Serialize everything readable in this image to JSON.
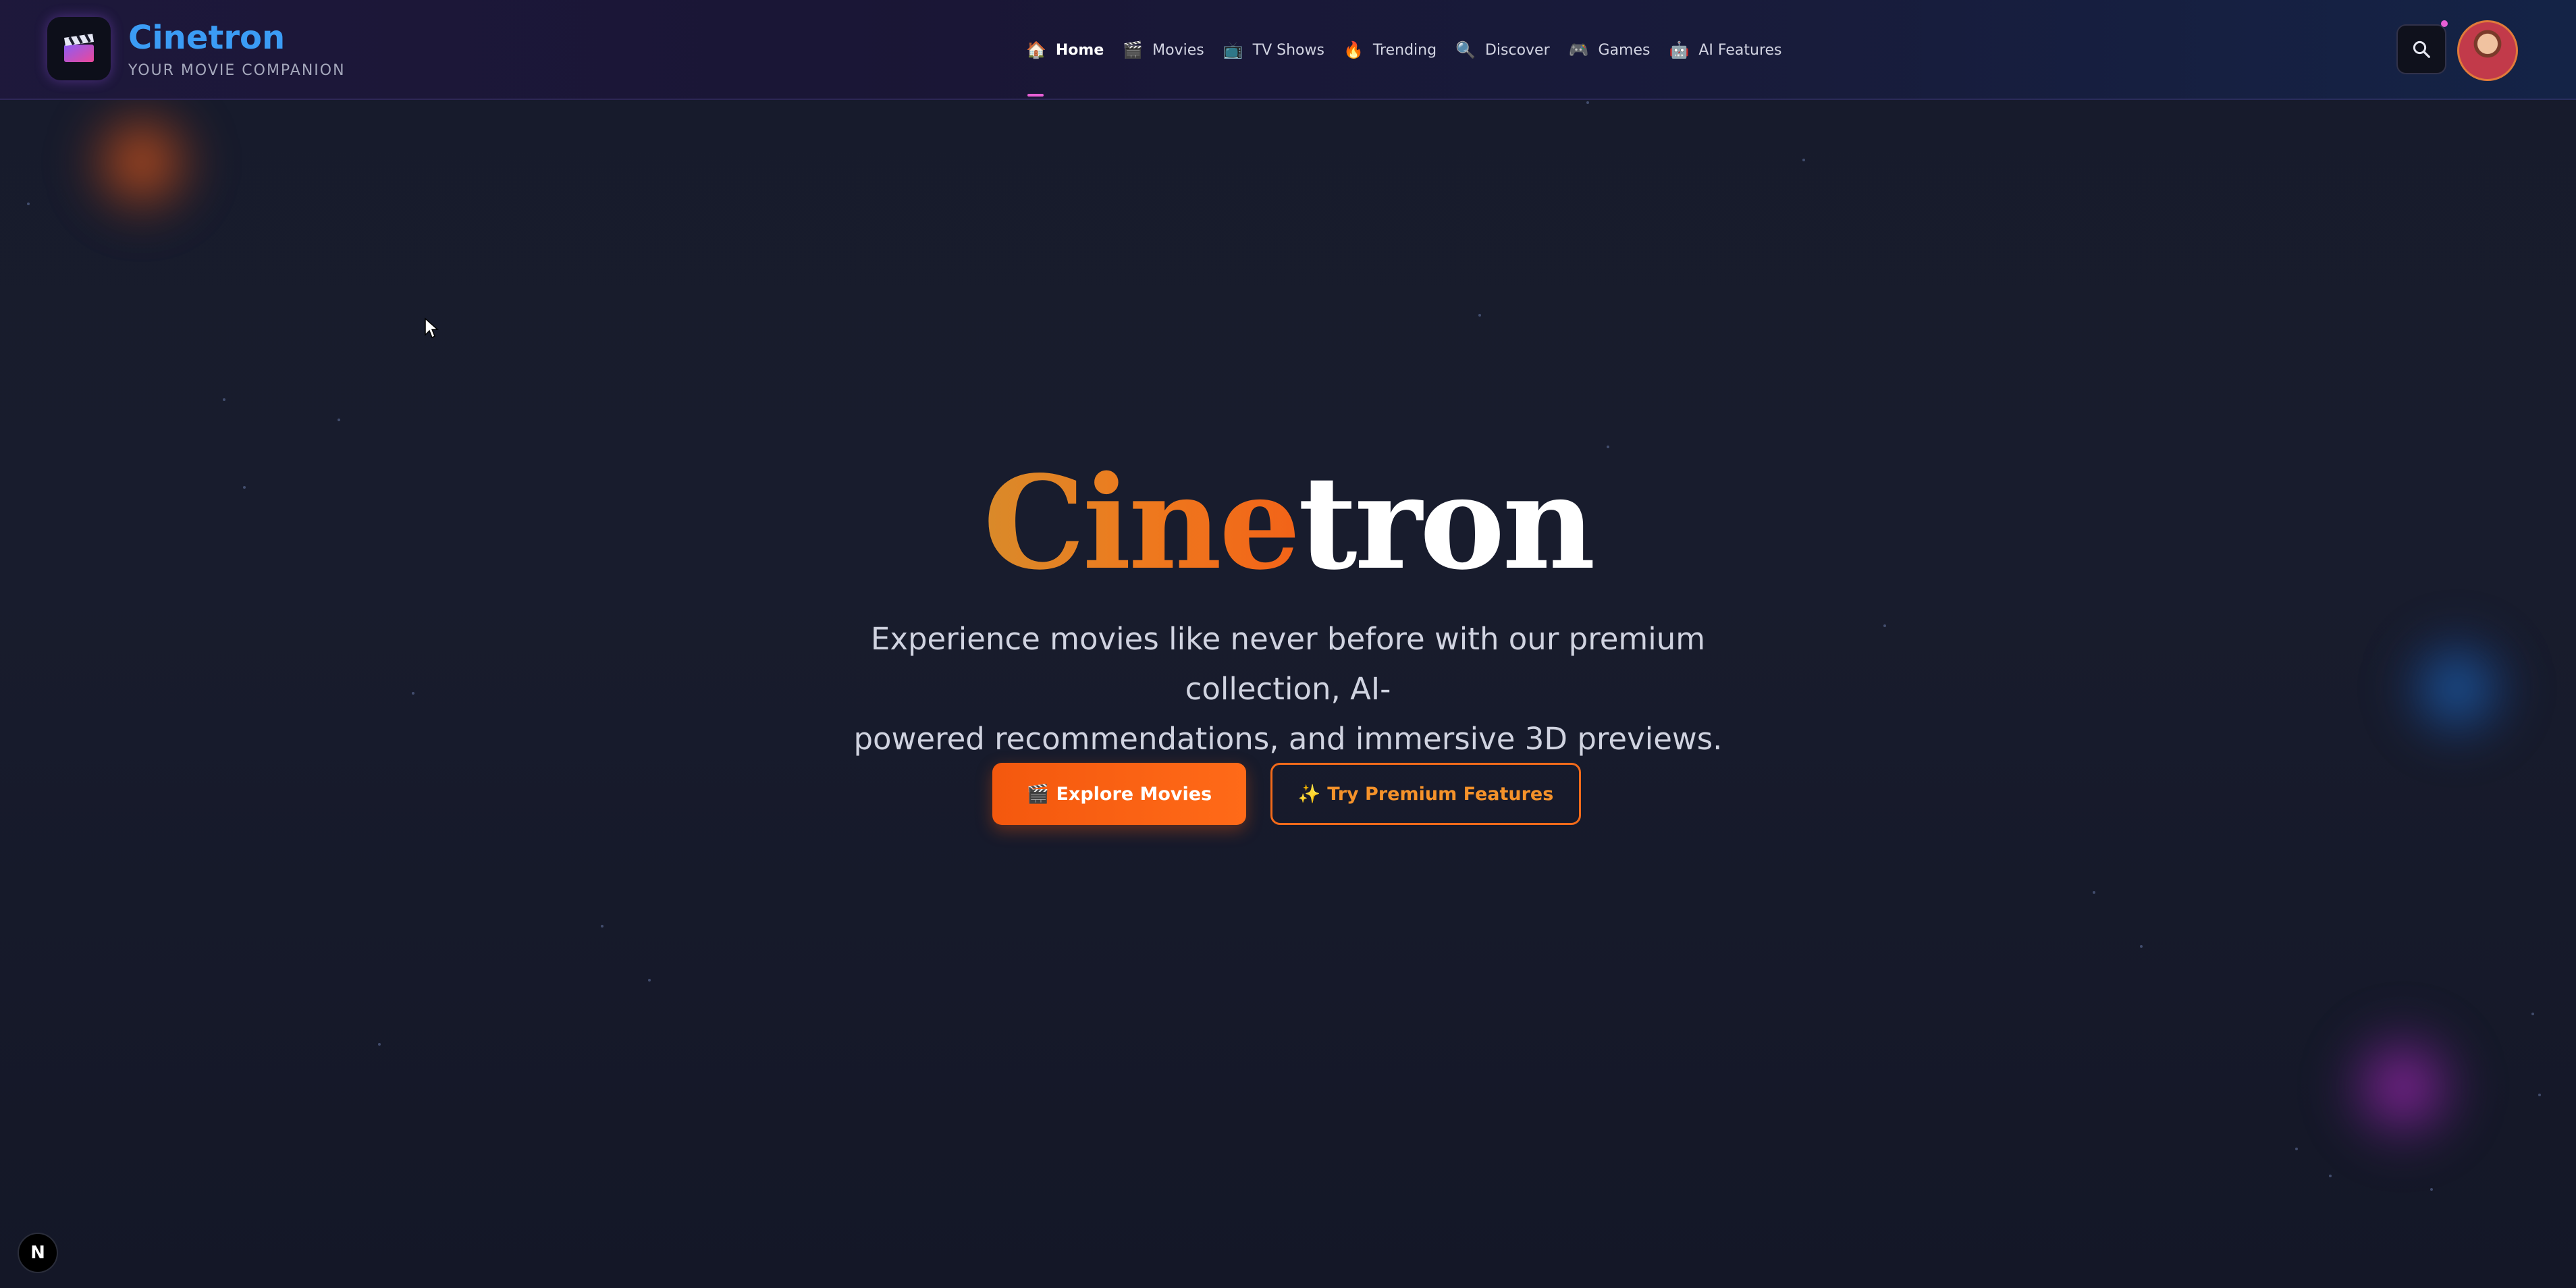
{
  "brand": {
    "title": "Cinetron",
    "subtitle": "YOUR MOVIE COMPANION"
  },
  "nav": {
    "items": [
      {
        "icon": "🏠",
        "label": "Home",
        "active": true
      },
      {
        "icon": "🎬",
        "label": "Movies",
        "active": false
      },
      {
        "icon": "📺",
        "label": "TV Shows",
        "active": false
      },
      {
        "icon": "🔥",
        "label": "Trending",
        "active": false
      },
      {
        "icon": "🔍",
        "label": "Discover",
        "active": false
      },
      {
        "icon": "🎮",
        "label": "Games",
        "active": false
      },
      {
        "icon": "🤖",
        "label": "AI Features",
        "active": false
      }
    ]
  },
  "hero": {
    "title_part1": "Cine",
    "title_part2": "tron",
    "subtitle_line1": "Experience movies like never before with our premium collection, AI-",
    "subtitle_line2": "powered recommendations, and immersive 3D previews.",
    "primary_icon": "🎬",
    "primary_label": "Explore Movies",
    "secondary_icon": "✨",
    "secondary_label": "Try Premium Features"
  },
  "dev_badge": "N",
  "colors": {
    "accent_orange": "#f4580e",
    "brand_blue": "#3b9cf5",
    "nav_indicator": "#e85fd6",
    "background": "#161a2a"
  }
}
